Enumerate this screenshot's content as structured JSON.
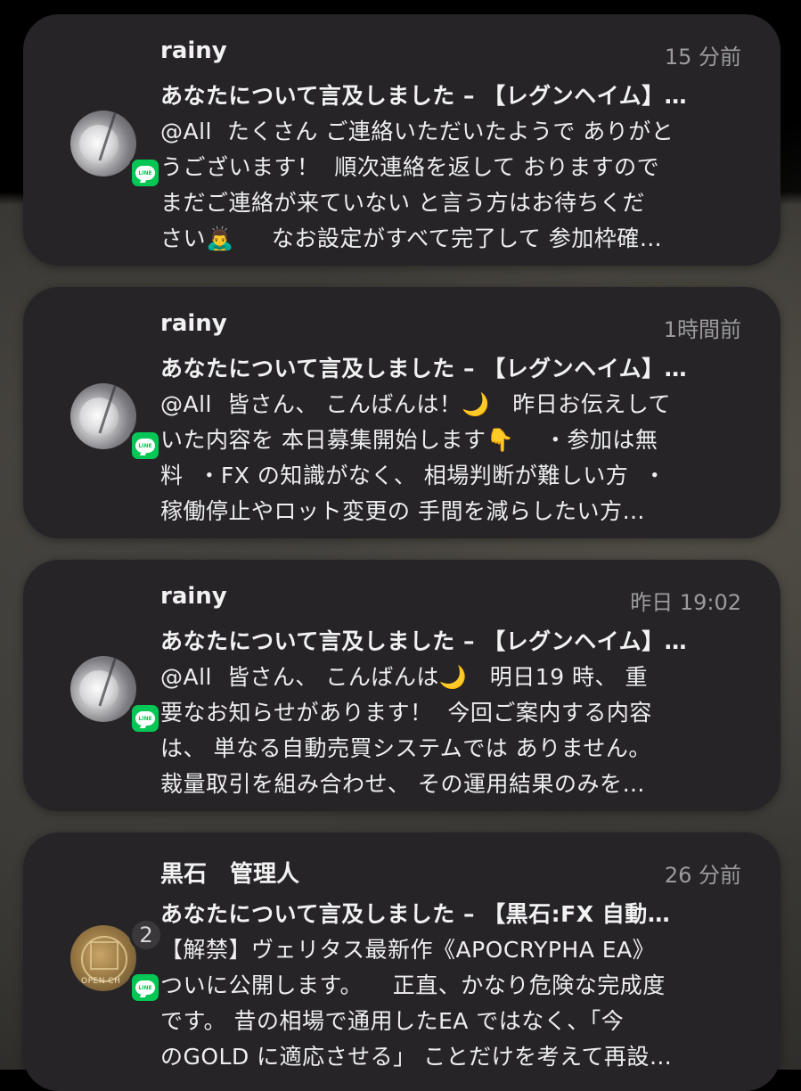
{
  "notifications": [
    {
      "sender": "rainy",
      "time": "15 分前",
      "title": "あなたについて言及しました – 【レグンヘイム】…",
      "body": "@All  たくさん ご連絡いただいたようで ありがと\nうございます！  順次連絡を返して おりますので\nまだご連絡が来ていない と言う方はお待ちくだ\nさい🙇‍♂️     なお設定がすべて完了して 参加枠確…",
      "app_icon": "line-icon"
    },
    {
      "sender": "rainy",
      "time": "1時間前",
      "title": "あなたについて言及しました – 【レグンヘイム】…",
      "body": "@All  皆さん、 こんばんは！🌙   昨日お伝えして\nいた内容を 本日募集開始します👇    ・参加は無\n料  ・FX の知識がなく、 相場判断が難しい方  ・\n稼働停止やロット変更の 手間を減らしたい方…",
      "app_icon": "line-icon"
    },
    {
      "sender": "rainy",
      "time": "昨日 19:02",
      "title": "あなたについて言及しました – 【レグンヘイム】…",
      "body": "@All  皆さん、 こんばんは🌙   明日19 時、 重\n要なお知らせがあります！  今回ご案内する内容\nは、 単なる自動売買システムでは ありません。\n裁量取引を組み合わせ、 その運用結果のみを…",
      "app_icon": "line-icon"
    },
    {
      "sender": "黒石　管理人",
      "time": "26 分前",
      "title": "あなたについて言及しました – 【黒石:FX 自動…",
      "body": "【解禁】ヴェリタス最新作《APOCRYPHA EA》\nついに公開します。    正直、かなり危険な完成度\nです。 昔の相場で通用したEA ではなく、「今\nのGOLD に適応させる」 ことだけを考えて再設…",
      "app_icon": "line-icon",
      "count_badge": "2",
      "avatar_text": "OPEN CH"
    }
  ],
  "line_badge_label": "LINE",
  "colors": {
    "card_bg": "#262427",
    "line_green": "#06c755",
    "secondary_text": "#9c9b9f"
  }
}
